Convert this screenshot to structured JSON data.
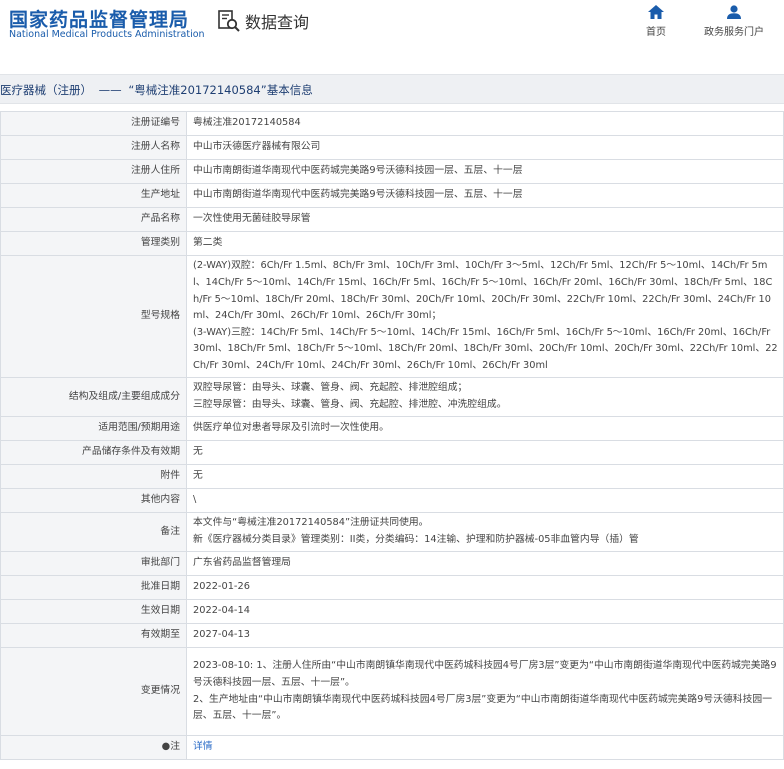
{
  "header": {
    "logo_cn": "国家药品监督管理局",
    "logo_en": "National Medical Products Administration",
    "query_label": "数据查询",
    "nav": [
      {
        "label": "首页",
        "icon": "home-icon"
      },
      {
        "label": "政务服务门户",
        "icon": "user-icon"
      }
    ],
    "accent_color": "#1a5cab"
  },
  "breadcrumb": {
    "section": "医疗器械（注册）",
    "separator": "——",
    "title": "“粤械注准20172140584”基本信息"
  },
  "rows": [
    {
      "key": "注册证编号",
      "value": "粤械注准20172140584"
    },
    {
      "key": "注册人名称",
      "value": "中山市沃德医疗器械有限公司"
    },
    {
      "key": "注册人住所",
      "value": "中山市南朗街道华南现代中医药城完美路9号沃德科技园一层、五层、十一层"
    },
    {
      "key": "生产地址",
      "value": "中山市南朗街道华南现代中医药城完美路9号沃德科技园一层、五层、十一层"
    },
    {
      "key": "产品名称",
      "value": "一次性使用无菌硅胶导尿管"
    },
    {
      "key": "管理类别",
      "value": "第二类"
    },
    {
      "key": "型号规格",
      "lines": [
        "(2-WAY)双腔：6Ch/Fr 1.5ml、8Ch/Fr 3ml、10Ch/Fr 3ml、10Ch/Fr 3～5ml、12Ch/Fr 5ml、12Ch/Fr 5～10ml、14Ch/Fr 5ml、14Ch/Fr 5～10ml、14Ch/Fr 15ml、16Ch/Fr 5ml、16Ch/Fr 5～10ml、16Ch/Fr 20ml、16Ch/Fr 30ml、18Ch/Fr 5ml、18Ch/Fr 5～10ml、18Ch/Fr 20ml、18Ch/Fr 30ml、20Ch/Fr 10ml、20Ch/Fr 30ml、22Ch/Fr 10ml、22Ch/Fr 30ml、24Ch/Fr 10ml、24Ch/Fr 30ml、26Ch/Fr 10ml、26Ch/Fr 30ml；",
        "(3-WAY)三腔：14Ch/Fr 5ml、14Ch/Fr 5～10ml、14Ch/Fr 15ml、16Ch/Fr 5ml、16Ch/Fr 5～10ml、16Ch/Fr 20ml、16Ch/Fr 30ml、18Ch/Fr 5ml、18Ch/Fr 5～10ml、18Ch/Fr 20ml、18Ch/Fr 30ml、20Ch/Fr 10ml、20Ch/Fr 30ml、22Ch/Fr 10ml、22Ch/Fr 30ml、24Ch/Fr 10ml、24Ch/Fr 30ml、26Ch/Fr 10ml、26Ch/Fr 30ml"
      ]
    },
    {
      "key": "结构及组成/主要组成成分",
      "lines": [
        "双腔导尿管：由导头、球囊、管身、阀、充起腔、排泄腔组成；",
        "三腔导尿管：由导头、球囊、管身、阀、充起腔、排泄腔、冲洗腔组成。"
      ]
    },
    {
      "key": "适用范围/预期用途",
      "value": "供医疗单位对患者导尿及引流时一次性使用。"
    },
    {
      "key": "产品储存条件及有效期",
      "value": "无"
    },
    {
      "key": "附件",
      "value": "无"
    },
    {
      "key": "其他内容",
      "value": "\\"
    },
    {
      "key": "备注",
      "lines": [
        "本文件与“粤械注准20172140584”注册证共同使用。",
        "新《医疗器械分类目录》管理类别：II类，分类编码：14注输、护理和防护器械-05非血管内导（插）管"
      ]
    },
    {
      "key": "审批部门",
      "value": "广东省药品监督管理局"
    },
    {
      "key": "批准日期",
      "value": "2022-01-26"
    },
    {
      "key": "生效日期",
      "value": "2022-04-14"
    },
    {
      "key": "有效期至",
      "value": "2027-04-13"
    },
    {
      "key": "变更情况",
      "lines": [
        "2023-08-10: 1、注册人住所由“中山市南朗镇华南现代中医药城科技园4号厂房3层”变更为“中山市南朗街道华南现代中医药城完美路9号沃德科技园一层、五层、十一层”。",
        "2、生产地址由“中山市南朗镇华南现代中医药城科技园4号厂房3层”变更为“中山市南朗街道华南现代中医药城完美路9号沃德科技园一层、五层、十一层”。"
      ]
    },
    {
      "key": "●注",
      "link": "详情"
    }
  ]
}
